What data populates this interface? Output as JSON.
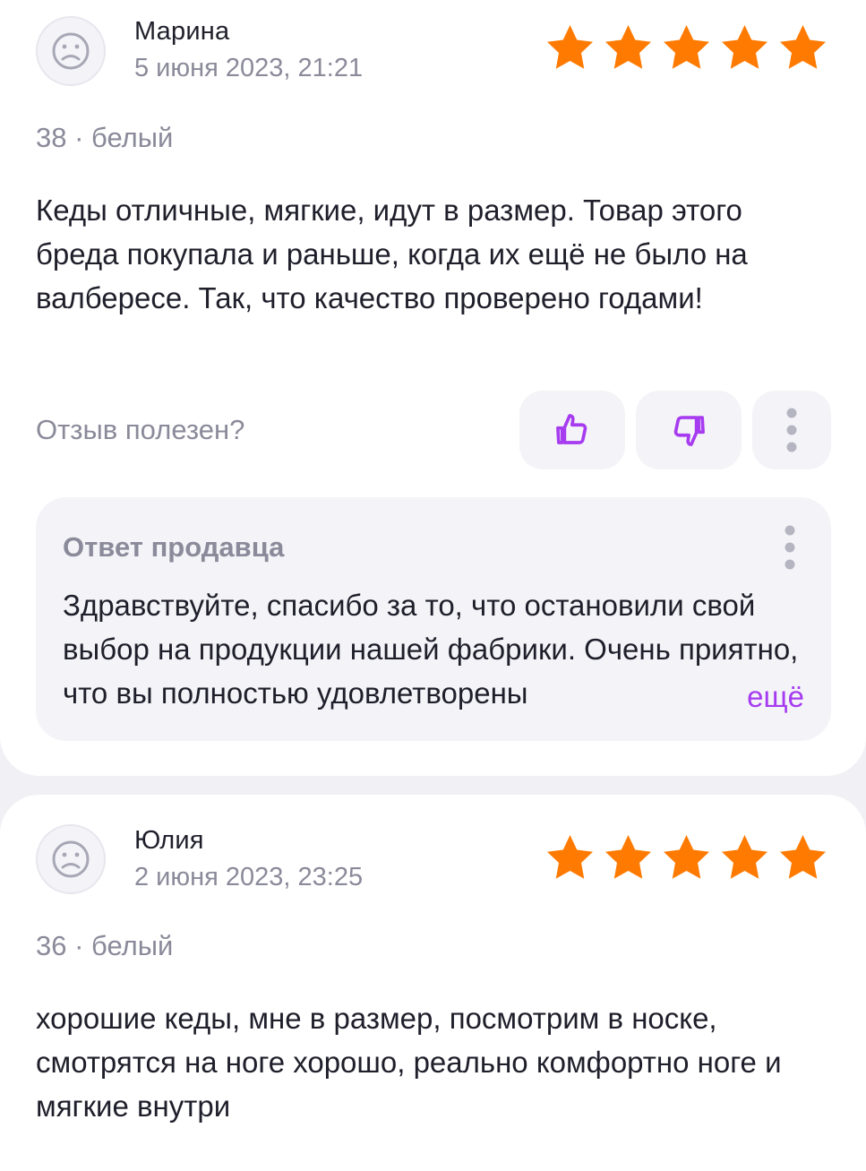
{
  "reviews": [
    {
      "author": "Марина",
      "date": "5 июня 2023, 21:21",
      "rating": 5,
      "variant": "38 · белый",
      "text": "Кеды отличные, мягкие, идут в размер. Товар этого бреда покупала и раньше, когда их ещё не было на валбересе. Так, что качество проверено годами!",
      "helpful_label": "Отзыв полезен?",
      "seller_reply": {
        "title": "Ответ продавца",
        "text": "Здравствуйте, спасибо за то, что остановили свой выбор на продукции нашей фабрики. Очень приятно, что вы полностью удовлетворены",
        "expand_label": "ещё"
      }
    },
    {
      "author": "Юлия",
      "date": "2 июня 2023, 23:25",
      "rating": 5,
      "variant": "36 · белый",
      "text": "хорошие кеды, мне в размер, посмотрим в носке, смотрятся на ноге хорошо, реально комфортно ноге и мягкие внутри"
    }
  ],
  "colors": {
    "star": "#ff7a00",
    "accent": "#a63bf0",
    "muted_text": "#8a8a9a",
    "text": "#1f1f2b",
    "button_bg": "#f4f4f8"
  },
  "icons": {
    "avatar": "sad-face-avatar-icon",
    "star": "star-icon",
    "like": "thumbs-up-icon",
    "dislike": "thumbs-down-icon",
    "more": "vertical-dots-icon"
  }
}
